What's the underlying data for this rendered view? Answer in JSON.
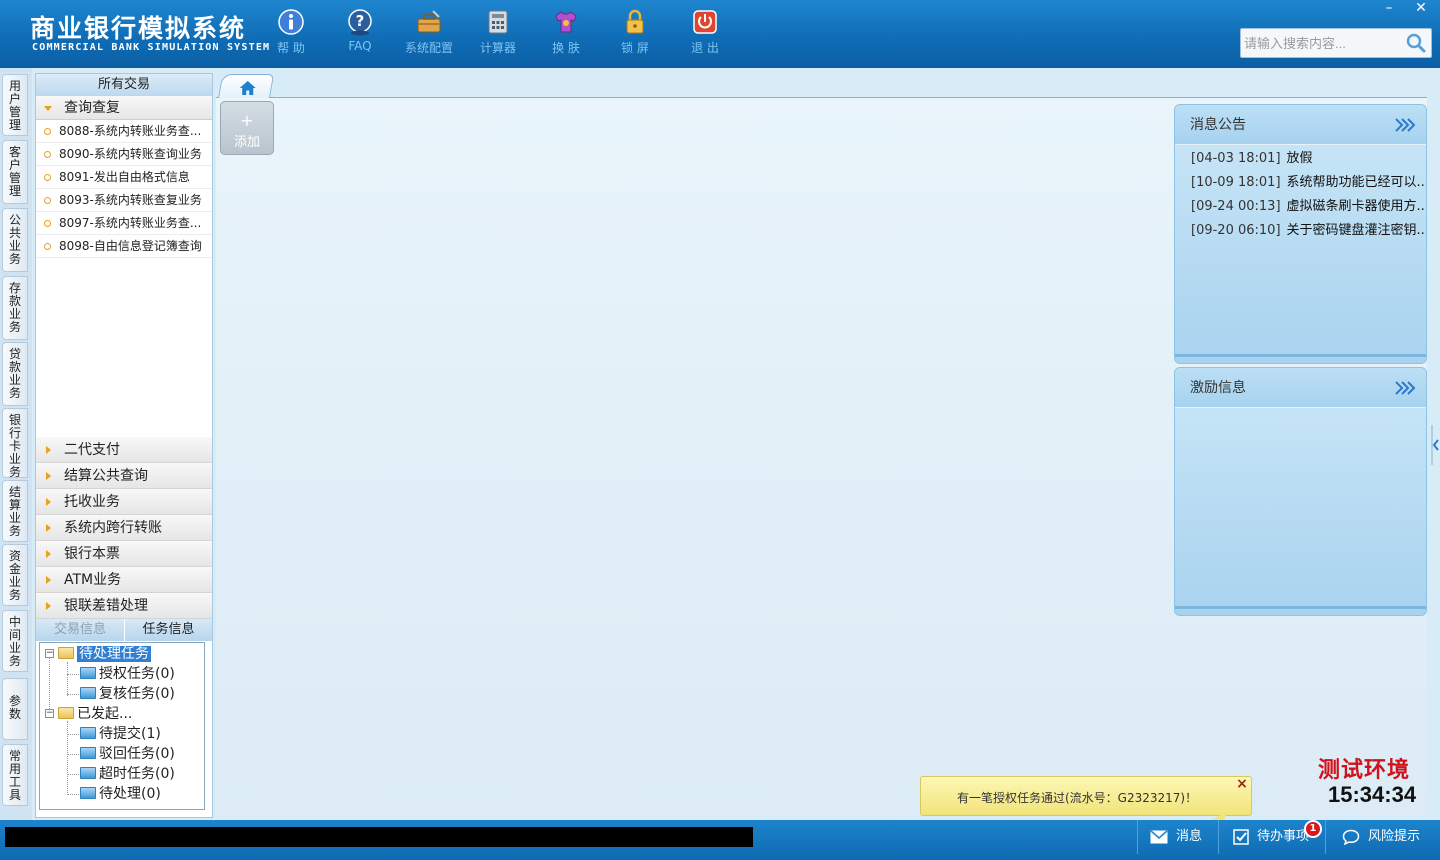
{
  "app": {
    "title_cn": "商业银行模拟系统",
    "title_en": "COMMERCIAL BANK SIMULATION SYSTEM"
  },
  "toolbar": [
    {
      "label": "帮 助",
      "icon": "info-icon"
    },
    {
      "label": "FAQ",
      "icon": "question-icon"
    },
    {
      "label": "系统配置",
      "icon": "toolbox-icon"
    },
    {
      "label": "计算器",
      "icon": "calculator-icon"
    },
    {
      "label": "换 肤",
      "icon": "tshirt-icon"
    },
    {
      "label": "锁 屏",
      "icon": "lock-icon"
    },
    {
      "label": "退 出",
      "icon": "power-icon"
    }
  ],
  "search": {
    "placeholder": "请输入搜索内容..."
  },
  "window_controls": {
    "minimize": "–",
    "close": "✕"
  },
  "vertical_tabs": [
    "用户管理",
    "客户管理",
    "公共业务",
    "存款业务",
    "贷款业务",
    "银行卡业务",
    "结算业务",
    "资金业务",
    "中间业务",
    "参数",
    "常用工具"
  ],
  "left_panel": {
    "header": "所有交易",
    "open_group": "查询查复",
    "transactions": [
      "8088-系统内转账业务查...",
      "8090-系统内转账查询业务",
      "8091-发出自由格式信息",
      "8093-系统内转账查复业务",
      "8097-系统内转账业务查...",
      "8098-自由信息登记簿查询"
    ],
    "groups": [
      "二代支付",
      "结算公共查询",
      "托收业务",
      "系统内跨行转账",
      "银行本票",
      "ATM业务",
      "银联差错处理"
    ],
    "info_tabs": [
      "交易信息",
      "任务信息"
    ],
    "task_tree": {
      "pending_root": "待处理任务",
      "pending_children": [
        "授权任务(0)",
        "复核任务(0)"
      ],
      "initiated_root": "已发起...",
      "initiated_children": [
        "待提交(1)",
        "驳回任务(0)",
        "超时任务(0)",
        "待处理(0)"
      ]
    }
  },
  "main": {
    "home_tab_icon": "home-icon",
    "add_button_plus": "+",
    "add_button_label": "添加"
  },
  "notice_card": {
    "title": "消息公告",
    "items": [
      {
        "date": "[04-03 18:01]",
        "text": "放假"
      },
      {
        "date": "[10-09 18:01]",
        "text": "系统帮助功能已经可以..."
      },
      {
        "date": "[09-24 00:13]",
        "text": "虚拟磁条刷卡器使用方..."
      },
      {
        "date": "[09-20 06:10]",
        "text": "关于密码键盘灌注密钥..."
      }
    ]
  },
  "incentive_card": {
    "title": "激励信息"
  },
  "environment_label": "测试环境",
  "clock": "15:34:34",
  "toast": {
    "text": "有一笔授权任务通过(流水号：G2323217)！",
    "close": "×"
  },
  "statusbar": {
    "message_label": "消息",
    "todo_label": "待办事项",
    "todo_badge": "1",
    "risk_label": "风险提示"
  },
  "colors": {
    "header_blue": "#1f86cf",
    "statusbar_blue": "#1d84cc",
    "accent_orange": "#e8a020",
    "env_red": "#d0121b",
    "badge_red": "#d8171f"
  }
}
